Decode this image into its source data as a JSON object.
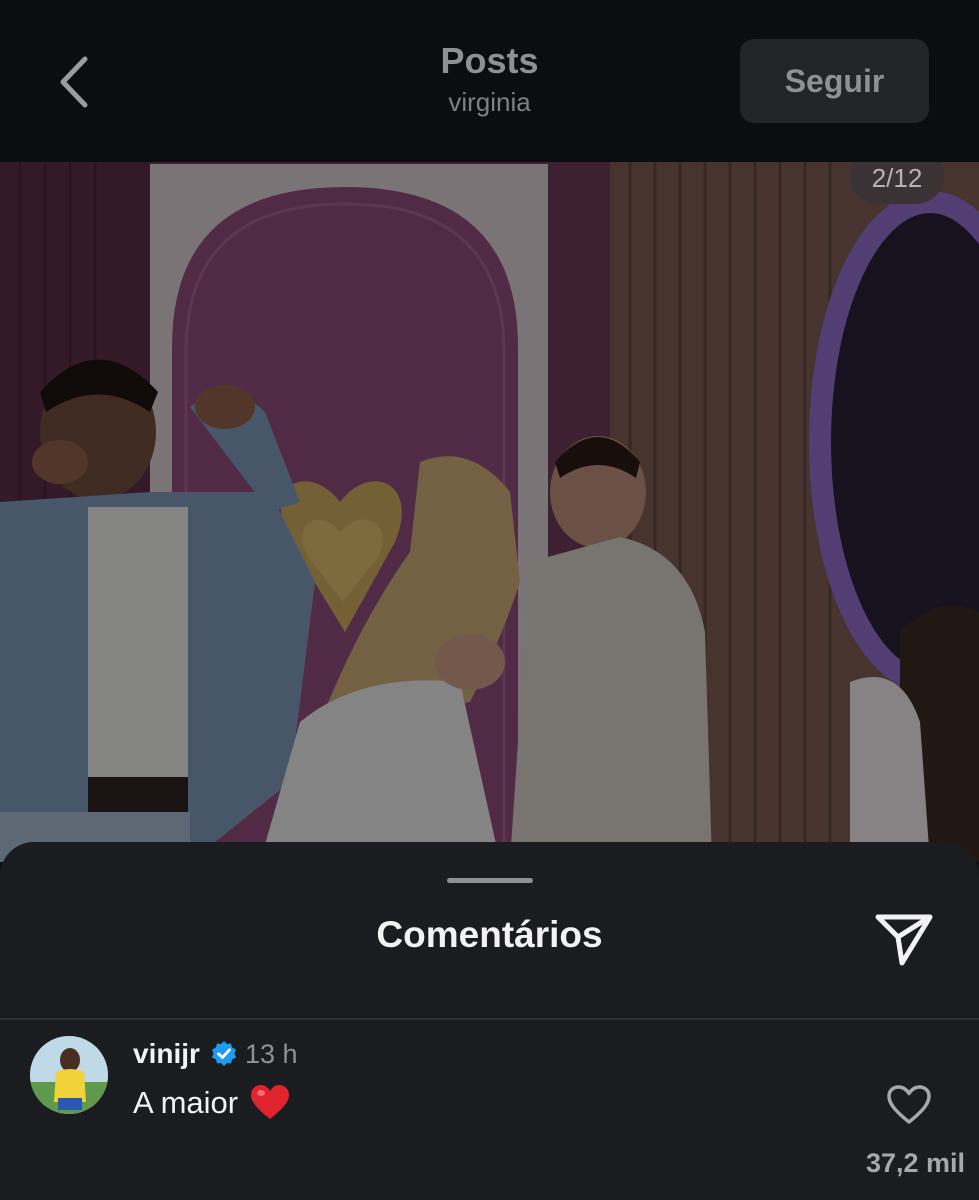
{
  "header": {
    "title": "Posts",
    "username": "virginia",
    "follow_label": "Seguir"
  },
  "post": {
    "image_counter": "2/12"
  },
  "comments_sheet": {
    "title": "Comentários",
    "comments": [
      {
        "username": "vinijr",
        "verified": true,
        "time": "13 h",
        "text": "A maior",
        "emoji": "red-heart",
        "likes": "37,2 mil"
      }
    ]
  },
  "icons": {
    "back": "chevron-left-icon",
    "share": "paper-plane-icon",
    "like": "heart-outline-icon",
    "verified": "verified-badge-icon"
  },
  "colors": {
    "background": "#0b0d10",
    "sheet": "#1a1c1f",
    "verified_blue": "#1d9bf0",
    "heart_red": "#e0242e"
  }
}
